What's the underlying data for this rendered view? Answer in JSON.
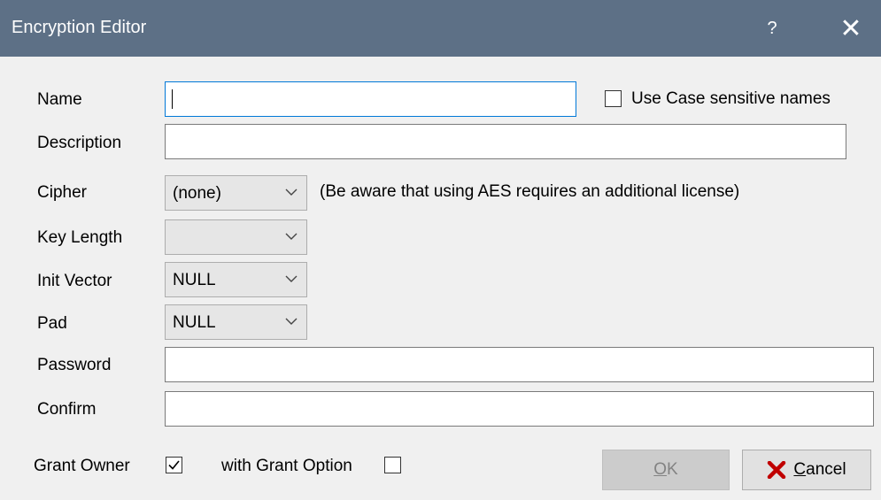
{
  "window": {
    "title": "Encryption Editor",
    "help_symbol": "?",
    "close_symbol": "✕"
  },
  "form": {
    "name": {
      "label": "Name",
      "value": ""
    },
    "case_sensitive": {
      "label": "Use Case sensitive names",
      "checked": false
    },
    "description": {
      "label": "Description",
      "value": ""
    },
    "cipher": {
      "label": "Cipher",
      "value": "(none)"
    },
    "cipher_note": "(Be aware that using AES requires an additional license)",
    "key_length": {
      "label": "Key Length",
      "value": ""
    },
    "init_vector": {
      "label": "Init Vector",
      "value": "NULL"
    },
    "pad": {
      "label": "Pad",
      "value": "NULL"
    },
    "password": {
      "label": "Password",
      "value": ""
    },
    "confirm": {
      "label": "Confirm",
      "value": ""
    },
    "grant_owner": {
      "label": "Grant Owner",
      "checked": true
    },
    "grant_option": {
      "label": "with Grant Option",
      "checked": false
    }
  },
  "buttons": {
    "ok": {
      "mnemonic": "O",
      "rest": "K",
      "enabled": false
    },
    "cancel": {
      "mnemonic": "C",
      "rest": "ancel",
      "icon": "red-x-icon"
    }
  },
  "colors": {
    "titlebar": "#5d7086",
    "focus_border": "#0078d7",
    "cancel_icon": "#c00000"
  }
}
